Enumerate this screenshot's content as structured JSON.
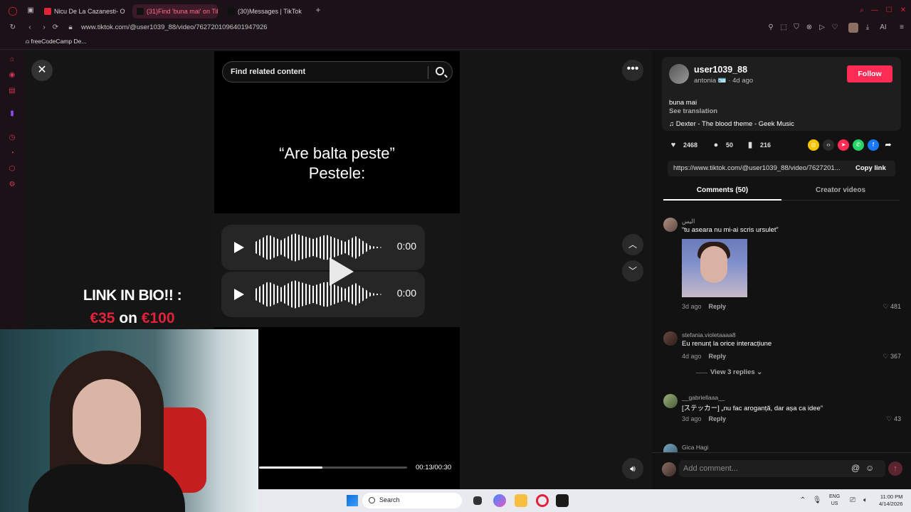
{
  "browser": {
    "tabs": [
      {
        "label": "Nicu De La Cazanesti- Of"
      },
      {
        "label": "(31)Find 'buna mai' on Tik"
      },
      {
        "label": "(30)Messages | TikTok"
      }
    ],
    "new_tab_label": "+",
    "url": "www.tiktok.com/@user1039_88/video/7627201096401947926",
    "bookmark": "freeCodeCamp De...",
    "ai_label": "AI"
  },
  "search": {
    "placeholder": "Find related content"
  },
  "video": {
    "quote_line1": "“Are balta peste”",
    "quote_line2": "Pestele:",
    "voice1_time": "0:00",
    "voice2_time": "0:00",
    "progress": 0.43,
    "time": "00:13/00:30"
  },
  "promo": {
    "line1": "LINK IN BIO!! :",
    "amount1": "€35",
    "on": " on ",
    "amount2": "€100"
  },
  "author": {
    "username": "user1039_88",
    "subline": "antonia 🪪 · 4d ago",
    "follow_label": "Follow",
    "caption": "buna mai",
    "see_translation": "See translation",
    "music": "♫  Dexter - The blood theme - Geek Music"
  },
  "stats": {
    "likes": "2468",
    "comments": "50",
    "saves": "216"
  },
  "share": {
    "link": "https://www.tiktok.com/@user1039_88/video/7627201...",
    "copy_label": "Copy link"
  },
  "tabs": {
    "comments": "Comments (50)",
    "creator": "Creator videos"
  },
  "comments": [
    {
      "user": "اليس",
      "text": "“tu aseara nu mi-ai scris ursulet”",
      "time": "3d ago",
      "reply": "Reply",
      "likes": "481"
    },
    {
      "user": "stefania.violetaaaa8",
      "text": "Eu renunț la orice interacțiune",
      "time": "4d ago",
      "reply": "Reply",
      "likes": "367",
      "view_replies": "View 3 replies ⌄"
    },
    {
      "user": "__gabriellaaa__",
      "text": "[ステッカー] „nu fac aroganță, dar așa ca idee”",
      "time": "3d ago",
      "reply": "Reply",
      "likes": "43"
    },
    {
      "user": "Gica Hagi"
    }
  ],
  "comment_box": {
    "placeholder": "Add comment..."
  },
  "taskbar": {
    "search_label": "Search",
    "lang_line1": "ENG",
    "lang_line2": "US",
    "time": "11:00 PM",
    "date": "4/14/2026"
  },
  "colors": {
    "accent": "#fe2c55",
    "browser_accent": "#ff6d8c"
  }
}
